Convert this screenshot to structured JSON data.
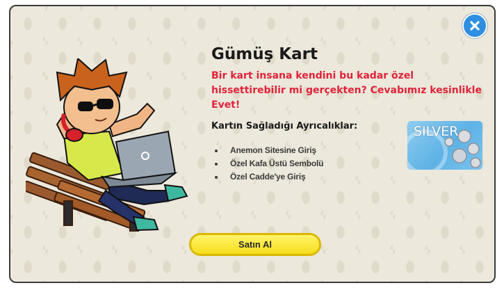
{
  "dialog": {
    "title": "Gümüş Kart",
    "subtitle": "Bir kart insana kendini bu kadar özel hissettirebilir mi gerçekten? Cevabımız kesinlikle Evet!",
    "features_heading": "Kartın Sağladığı Ayrıcalıklar:",
    "features": [
      "Anemon Sitesine Giriş",
      "Özel Kafa Üstü Sembolü",
      "Özel Cadde'ye Giriş"
    ],
    "card_label": "SILVER",
    "buy_label": "Satın Al",
    "icons": {
      "close": "close-icon",
      "character": "character-illustration",
      "card": "silver-card-image"
    },
    "colors": {
      "subtitle": "#e0233a",
      "close_button": "#2f8ee0",
      "buy_button": "#f5de1c",
      "card": "#5eb2e6"
    }
  }
}
